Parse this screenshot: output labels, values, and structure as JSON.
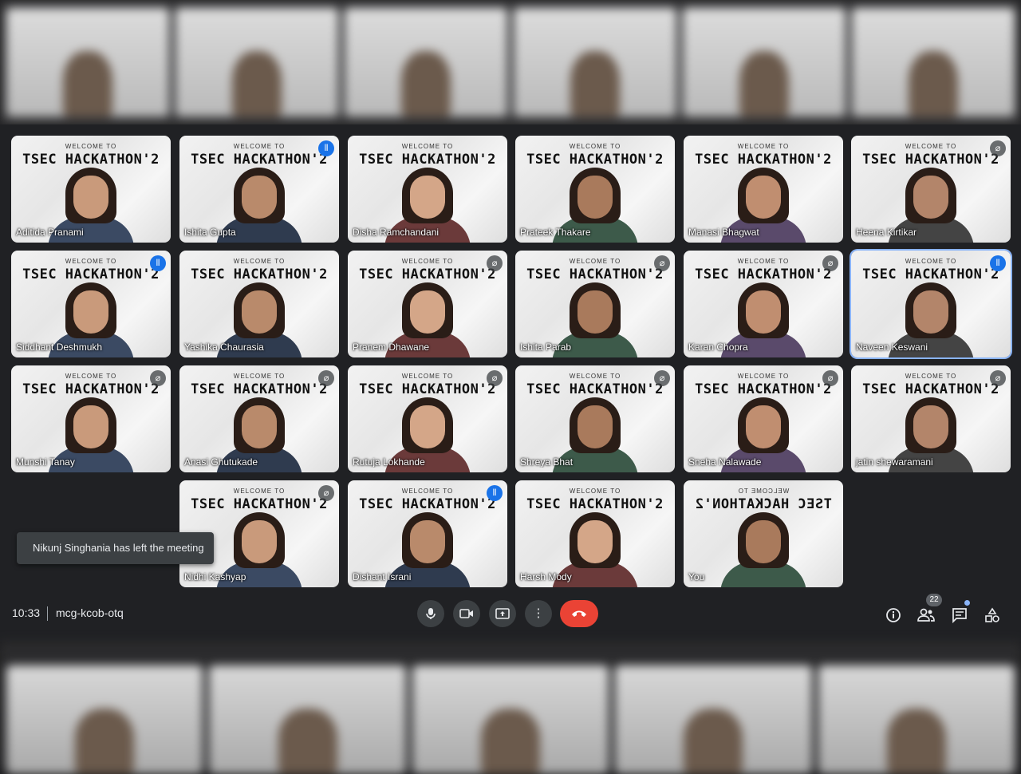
{
  "meeting": {
    "time": "10:33",
    "code": "mcg-kcob-otq",
    "participant_count": "22",
    "toast": "Nikunj Singhania has left the meeting"
  },
  "background": {
    "welcome_text": "WELCOME TO",
    "banner_text": "TSEC HACKATHON'2"
  },
  "tiles": [
    {
      "name": "Aditida Pranami",
      "badge": "",
      "mirrored": false
    },
    {
      "name": "Ishita Gupta",
      "badge": "speaking",
      "mirrored": false
    },
    {
      "name": "Disha Ramchandani",
      "badge": "",
      "mirrored": false
    },
    {
      "name": "Prateek Thakare",
      "badge": "",
      "mirrored": false
    },
    {
      "name": "Manasi Bhagwat",
      "badge": "",
      "mirrored": false
    },
    {
      "name": "Heena Kirtikar",
      "badge": "muted",
      "mirrored": false
    },
    {
      "name": "Siddhant Deshmukh",
      "badge": "speaking",
      "mirrored": false
    },
    {
      "name": "Yashika Chaurasia",
      "badge": "",
      "mirrored": false
    },
    {
      "name": "Pranem Dhawane",
      "badge": "muted",
      "mirrored": false
    },
    {
      "name": "Ishita Parab",
      "badge": "muted",
      "mirrored": false
    },
    {
      "name": "Karan Chopra",
      "badge": "muted",
      "mirrored": false
    },
    {
      "name": "Naveen Keswani",
      "badge": "speaking",
      "mirrored": false
    },
    {
      "name": "Munshi Tanay",
      "badge": "muted",
      "mirrored": false
    },
    {
      "name": "Anasi Ghutukade",
      "badge": "muted",
      "mirrored": false
    },
    {
      "name": "Rutuja Lokhande",
      "badge": "muted",
      "mirrored": false
    },
    {
      "name": "Shreya Bhat",
      "badge": "muted",
      "mirrored": false
    },
    {
      "name": "Sneha Nalawade",
      "badge": "muted",
      "mirrored": false
    },
    {
      "name": "jatin shewaramani",
      "badge": "muted",
      "mirrored": false
    },
    {
      "name": "Nidhi Kashyap",
      "badge": "muted",
      "mirrored": false
    },
    {
      "name": "Dishant Israni",
      "badge": "speaking",
      "mirrored": false
    },
    {
      "name": "Harsh Mody",
      "badge": "",
      "mirrored": false
    },
    {
      "name": "You",
      "badge": "",
      "mirrored": true
    }
  ],
  "colors": {
    "accent": "#8ab4f8",
    "speaking": "#1a73e8",
    "hangup": "#ea4335",
    "background": "#202124"
  },
  "icons": {
    "mic": "mic-icon",
    "camera": "camera-icon",
    "present": "present-icon",
    "more": "more-options-icon",
    "hangup": "hangup-icon",
    "info": "info-icon",
    "people": "people-icon",
    "chat": "chat-icon",
    "activities": "activities-icon"
  }
}
